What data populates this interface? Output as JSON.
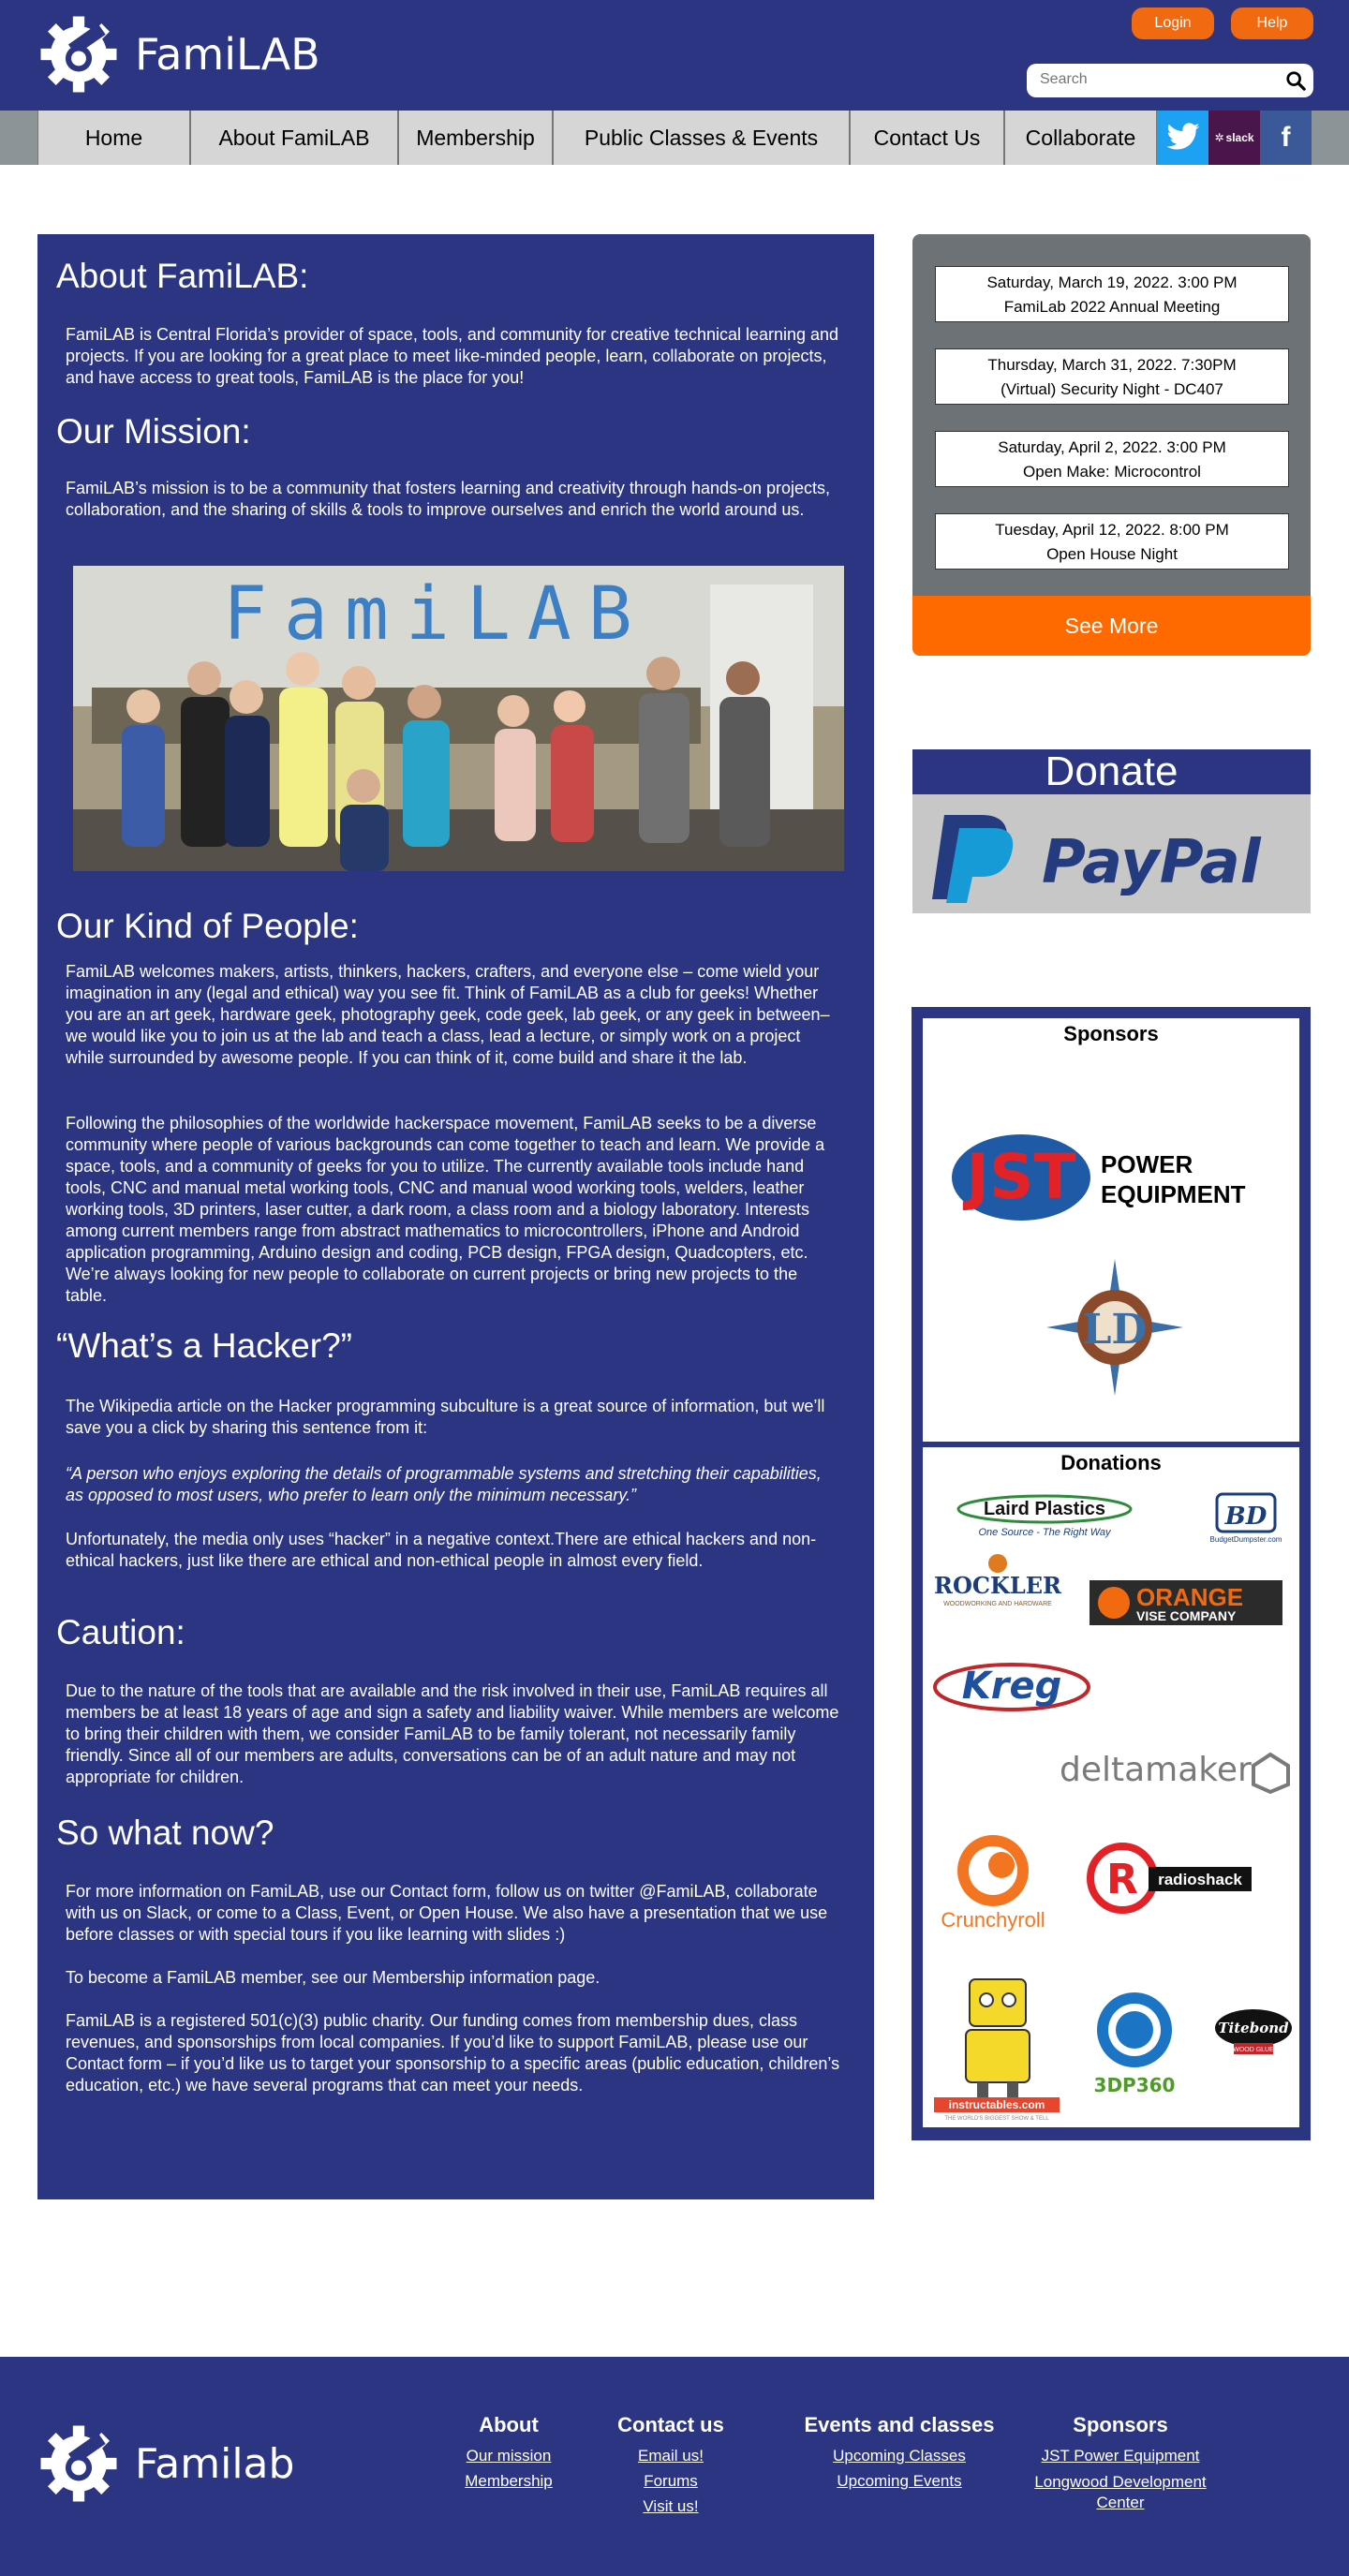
{
  "header": {
    "logo_text": "FamiLAB",
    "login_label": "Login",
    "help_label": "Help",
    "search_placeholder": "Search"
  },
  "nav": {
    "items": [
      "Home",
      "About FamiLAB",
      "Membership",
      "Public Classes & Events",
      "Contact Us",
      "Collaborate"
    ],
    "slack_label": "slack",
    "facebook_label": "f"
  },
  "main": {
    "about_heading": "About FamiLAB:",
    "about_text": "FamiLAB is Central Florida’s provider of space, tools, and community for creative technical learning and projects. If you are looking for a great place to meet like-minded people, learn, collaborate on projects, and have access to great tools, FamiLAB is the place for you!",
    "mission_heading": "Our Mission:",
    "mission_text": "FamiLAB’s mission is to be a community that fosters learning and creativity through hands-on projects, collaboration, and the sharing of skills & tools to improve ourselves and enrich the world around us.",
    "photo_sign": "FamiLAB",
    "people_heading": "Our Kind of People:",
    "people_text_1": "FamiLAB welcomes makers, artists, thinkers, hackers, crafters, and everyone else – come wield your imagination in any (legal and ethical) way you see fit. Think of FamiLAB as a club for geeks!  Whether you are an art geek, hardware geek, photography geek, code geek, lab geek, or any geek in between–we would like you to join us at the lab and teach a class, lead a lecture, or simply work on a project while surrounded by awesome people. If you can think of it, come build and share it the lab.",
    "people_text_2": "Following the philosophies of the worldwide hackerspace movement, FamiLAB seeks to be a diverse community where people of various backgrounds can come together to teach and learn. We provide a space, tools, and a community of geeks for you to utilize. The currently available tools include hand tools, CNC and manual metal working tools, CNC and manual wood working tools, welders, leather working tools, 3D printers, laser cutter, a dark room, a class room and a biology laboratory. Interests among current members range from abstract mathematics to microcontrollers, iPhone and Android application programming, Arduino design and coding, PCB design, FPGA design, Quadcopters, etc.  We’re always looking for new people to collaborate on current projects or bring new projects to the table.",
    "hacker_heading": "“What’s a Hacker?”",
    "hacker_text_1": "The Wikipedia article on the Hacker programming subculture is a great source of information, but we’ll save you a click by sharing this sentence from it:",
    "hacker_quote": "“A person who enjoys exploring the details of programmable systems and stretching their capabilities, as opposed to most users, who prefer to learn only the minimum necessary.”",
    "hacker_text_2": "Unfortunately, the media only uses “hacker” in a negative context.There are ethical hackers and non-ethical hackers, just like there are ethical and non-ethical people in almost every field.",
    "caution_heading": "Caution:",
    "caution_text": "Due to the nature of the tools that are available and the risk involved in their use, FamiLAB requires all members be at least 18 years of age and sign a safety and liability waiver. While members are welcome to bring their children with them, we consider FamiLAB to be family tolerant, not necessarily family friendly. Since all of our members are adults, conversations can be of an adult nature and may not appropriate for children.",
    "now_heading": "So what now?",
    "now_text_1": "For more information on FamiLAB, use our Contact form, follow us on twitter @FamiLAB, collaborate with us on Slack, or come to a Class, Event, or Open House. We also have a presentation that we use before classes or with special tours if you like learning with slides :)",
    "now_text_2": "To become a FamiLAB member, see our Membership information page.",
    "now_text_3": "FamiLAB is a registered 501(c)(3) public charity. Our funding comes from membership dues, class revenues, and sponsorships from local companies. If you’d like to support FamiLAB, please use our Contact form – if you’d like us to target your sponsorship to a specific areas (public education, children’s education, etc.) we have several programs that can meet your needs."
  },
  "events": {
    "items": [
      {
        "date": "Saturday, March 19, 2022. 3:00 PM",
        "title": "FamiLab 2022 Annual Meeting"
      },
      {
        "date": "Thursday, March 31, 2022. 7:30PM",
        "title": "(Virtual) Security Night - DC407"
      },
      {
        "date": "Saturday, April 2, 2022. 3:00 PM",
        "title": "Open Make: Microcontrol"
      },
      {
        "date": "Tuesday, April 12, 2022. 8:00 PM",
        "title": "Open House Night"
      }
    ],
    "see_more_label": "See More"
  },
  "donate": {
    "heading": "Donate",
    "paypal_text": "PayPal"
  },
  "sponsors": {
    "heading": "Sponsors",
    "jst_letters": "JST",
    "jst_line1": "POWER",
    "jst_line2": "EQUIPMENT",
    "ldc_letters": "LD",
    "donations_heading": "Donations",
    "laird_name": "Laird Plastics",
    "laird_tagline": "One Source - The Right Way",
    "bd_letters": "BD",
    "bd_name": "BudgetDumpster.com",
    "rockler_name": "ROCKLER",
    "rockler_tagline": "WOODWORKING AND HARDWARE",
    "orange_line1": "ORANGE",
    "orange_line2": "VISE COMPANY",
    "kreg_name": "Kreg",
    "deltamaker_name": "deltamaker",
    "crunchyroll_name": "Crunchyroll",
    "radioshack_letter": "R",
    "radioshack_name": "radioshack",
    "instructables_name": "instructables.com",
    "instructables_tagline": "THE WORLD'S BIGGEST SHOW & TELL",
    "dp360_name": "3DP360",
    "titebond_name": "Titebond",
    "titebond_tagline": "WOOD GLUE"
  },
  "footer": {
    "logo_text": "Familab",
    "about": {
      "heading": "About",
      "links": [
        "Our mission",
        "Membership"
      ]
    },
    "contact": {
      "heading": "Contact us",
      "links": [
        "Email us!",
        "Forums",
        "Visit us!"
      ]
    },
    "events": {
      "heading": "Events and classes",
      "links": [
        "Upcoming Classes",
        "Upcoming Events"
      ]
    },
    "sponsors": {
      "heading": "Sponsors",
      "links": [
        "JST Power Equipment",
        "Longwood Development Center"
      ]
    }
  }
}
